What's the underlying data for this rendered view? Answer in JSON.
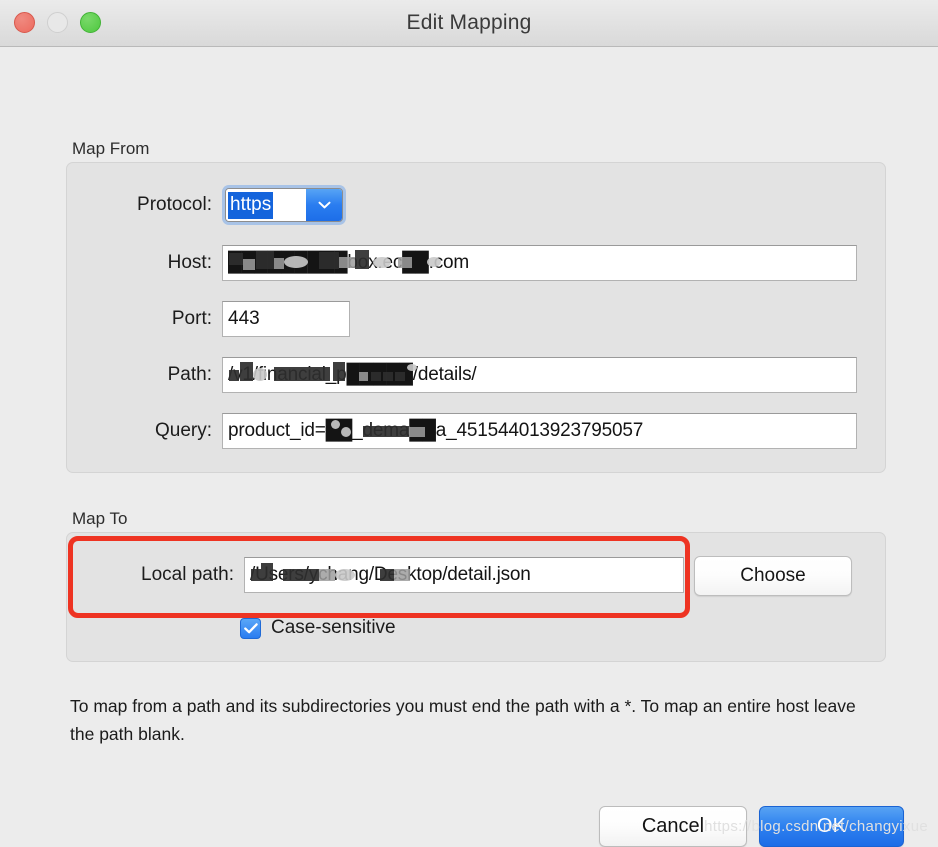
{
  "window": {
    "title": "Edit Mapping",
    "traffic_lights": [
      {
        "name": "close",
        "color": "#ec6a5e"
      },
      {
        "name": "minimize",
        "color": "#e8e8e8"
      },
      {
        "name": "zoom",
        "color": "#4ec83f"
      }
    ]
  },
  "map_from": {
    "group_label": "Map From",
    "protocol": {
      "label": "Protocol:",
      "value": "https",
      "selected": true,
      "dropdown_icon": "chevron-down-icon"
    },
    "host": {
      "label": "Host:",
      "value": "█████████box.ec██.com",
      "redacted": true
    },
    "port": {
      "label": "Port:",
      "value": "443"
    },
    "path": {
      "label": "Path:",
      "value": "/v1/financial_p█████/details/",
      "redacted": true
    },
    "query": {
      "label": "Query:",
      "value": "product_id=██_dema██a_451544013923795057",
      "redacted": true
    }
  },
  "map_to": {
    "group_label": "Map To",
    "local_path": {
      "label": "Local path:",
      "value": "/Users/ychang/Desktop/detail.json",
      "redacted": true
    },
    "choose_label": "Choose",
    "case_sensitive": {
      "label": "Case-sensitive",
      "checked": true
    }
  },
  "help_text": "To map from a path and its subdirectories you must end the path with a *. To map an entire host leave the path blank.",
  "footer": {
    "cancel_label": "Cancel",
    "ok_label": "OK"
  },
  "annotation": {
    "color": "#ee3322",
    "target": "local-path-row"
  },
  "watermark": "https://blog.csdn.net/changyixue",
  "colors": {
    "window_background": "#ececec",
    "group_background": "#e3e3e3",
    "accent_blue": "#2a7df0",
    "selection_blue": "#1464dc",
    "annotation_red": "#ee3322"
  }
}
